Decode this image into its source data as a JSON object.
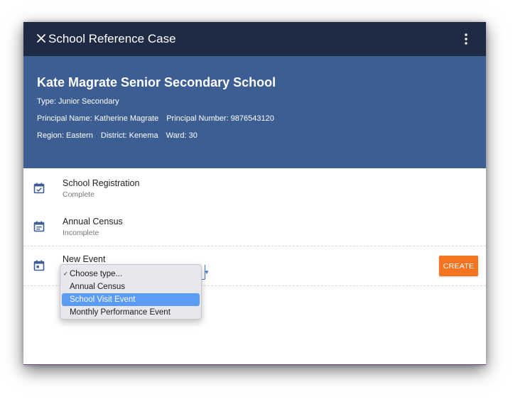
{
  "topbar": {
    "title": "School Reference Case",
    "close_icon": "close-icon",
    "menu_icon": "more-vertical-icon"
  },
  "header": {
    "school_name": "Kate Magrate Senior Secondary School",
    "type": "Type: Junior Secondary",
    "principal_name": "Principal Name: Katherine Magrate",
    "principal_number": "Principal Number: 9876543120",
    "region": "Region: Eastern",
    "district": "District: Kenema",
    "ward": "Ward: 30"
  },
  "events": [
    {
      "title": "School Registration",
      "status": "Complete",
      "icon": "calendar-check-icon"
    },
    {
      "title": "Annual Census",
      "status": "Incomplete",
      "icon": "calendar-notes-icon"
    }
  ],
  "new_event": {
    "title": "New Event",
    "icon": "calendar-today-icon",
    "create_label": "CREATE",
    "select": {
      "selected": "Choose type...",
      "highlighted": "School Visit Event",
      "options": [
        "Choose type...",
        "Annual Census",
        "School Visit Event",
        "Monthly Performance Event"
      ]
    }
  },
  "colors": {
    "topbar": "#1f2a44",
    "header": "#3d5e92",
    "accent": "#f57421",
    "highlight": "#5b9cf6",
    "icon": "#3d5e92"
  }
}
